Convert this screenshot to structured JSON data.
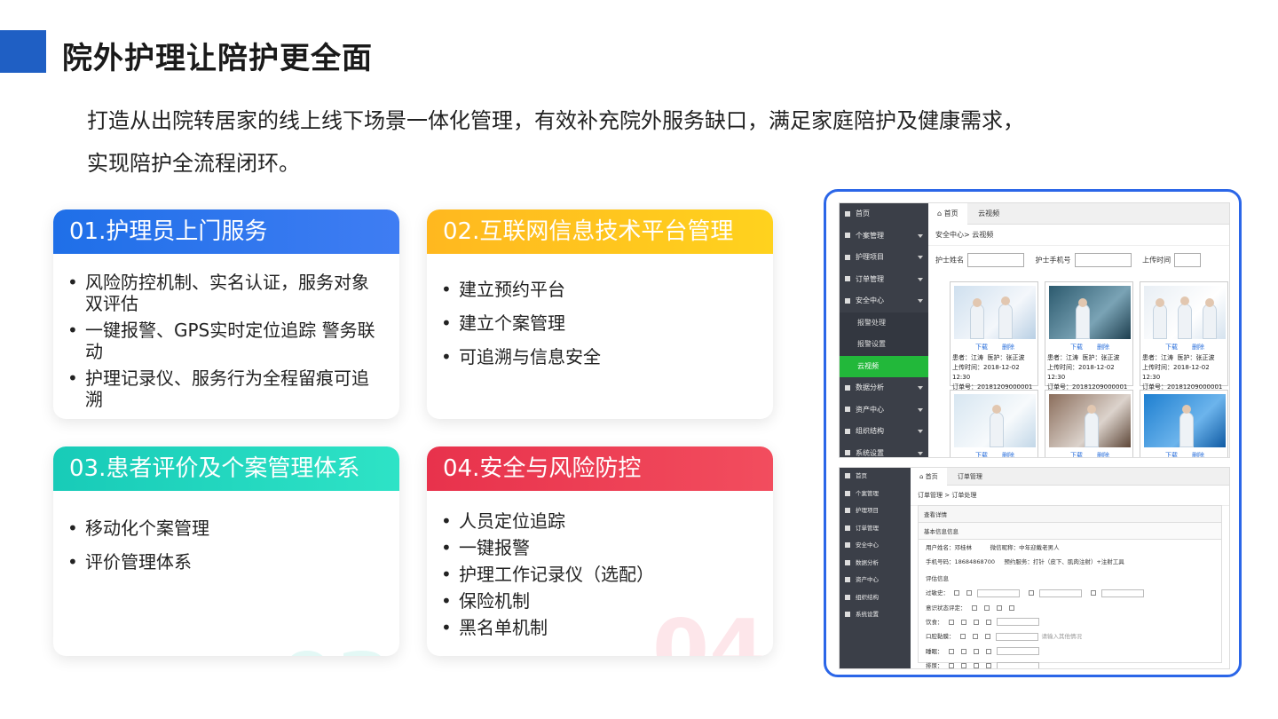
{
  "page": {
    "title": "院外护理让陪护更全面",
    "intro_line1": "打造从出院转居家的线上线下场景一体化管理，有效补充院外服务缺口，满足家庭陪护及健康需求，",
    "intro_line2": "实现陪护全流程闭环。"
  },
  "cards": [
    {
      "title": "01.护理员上门服务",
      "number": "01",
      "color": "#2a74ec",
      "items": [
        "风险防控机制、实名认证，服务对象双评估",
        "一键报警、GPS实时定位追踪 警务联动",
        "护理记录仪、服务行为全程留痕可追溯"
      ]
    },
    {
      "title": "02.互联网信息技术平台管理",
      "number": "02",
      "color": "#ffc41f",
      "items": [
        "建立预约平台",
        "建立个案管理",
        "可追溯与信息安全"
      ]
    },
    {
      "title": "03.患者评价及个案管理体系",
      "number": "03",
      "color": "#20d6bf",
      "items": [
        "移动化个案管理",
        "评价管理体系"
      ]
    },
    {
      "title": "04.安全与风险防控",
      "number": "04",
      "color": "#ec3a52",
      "items": [
        "人员定位追踪",
        "一键报警",
        "护理工作记录仪（选配）",
        "保险机制",
        "黑名单机制"
      ]
    }
  ],
  "screenshot1": {
    "sidebar": [
      "首页",
      "个案管理",
      "护理项目",
      "订单管理",
      "安全中心",
      "报警处理",
      "报警设置",
      "云视频",
      "数据分析",
      "资产中心",
      "组织结构",
      "系统设置"
    ],
    "tabs": [
      "首页",
      "云视频"
    ],
    "breadcrumb": "安全中心> 云视频",
    "filters": [
      "护士姓名",
      "护士手机号",
      "上传时间"
    ],
    "card_links": [
      "下载",
      "删除"
    ],
    "cards": [
      {
        "patient": "患者：江涛",
        "nurse": "医护：张正波",
        "upload": "上传时间：2018-12-02 12:30",
        "order": "订单号：20181209000001"
      },
      {
        "patient": "患者：江涛",
        "nurse": "医护：张正波",
        "upload": "上传时间：2018-12-02 12:30",
        "order": "订单号：20181209000001"
      },
      {
        "patient": "患者：江涛",
        "nurse": "医护：张正波",
        "upload": "上传时间：2018-12-02 12:30",
        "order": "订单号：20181209000001"
      }
    ]
  },
  "screenshot2": {
    "sidebar": [
      "首页",
      "个案管理",
      "护理项目",
      "订单管理",
      "安全中心",
      "数据分析",
      "资产中心",
      "组织结构",
      "系统设置"
    ],
    "tabs": [
      "首页",
      "订单管理"
    ],
    "breadcrumb": "订单管理 > 订单处理",
    "panel_title": "查看详情",
    "basic_info": "基本信息信息",
    "user_name": "用户姓名：邓桂林",
    "phone": "手机号码：18684868700",
    "guarantor": "微信昵称：中年迎戴老男人",
    "service": "预约服务：打针（皮下、肌肉注射）+注射工具",
    "assess": "评估信息",
    "rows": [
      "过敏史：",
      "意识状态评定：",
      "饮食：",
      "口腔黏膜：",
      "睡眠：",
      "排尿："
    ],
    "hint": "请输入其他情况"
  }
}
